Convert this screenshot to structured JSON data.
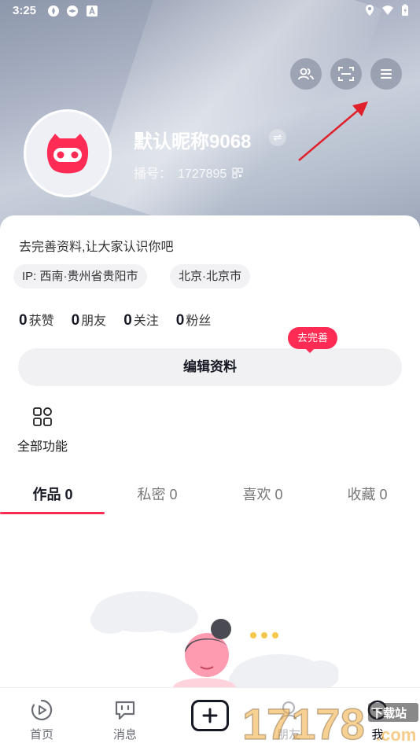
{
  "status_bar": {
    "time": "3:25"
  },
  "profile": {
    "nickname": "默认昵称9068",
    "account_label": "播号：",
    "account_id": "1727895",
    "complete_prompt": "去完善资料,让大家认识你吧",
    "tags": [
      "IP: 西南·贵州省贵阳市",
      "北京·北京市"
    ]
  },
  "stats": [
    {
      "count": "0",
      "label": "获赞"
    },
    {
      "count": "0",
      "label": "朋友"
    },
    {
      "count": "0",
      "label": "关注"
    },
    {
      "count": "0",
      "label": "粉丝"
    }
  ],
  "edit": {
    "bubble": "去完善",
    "button_label": "编辑资料"
  },
  "all_functions": "全部功能",
  "tabs": [
    {
      "label": "作品 0",
      "active": true
    },
    {
      "label": "私密 0",
      "active": false
    },
    {
      "label": "喜欢 0",
      "active": false
    },
    {
      "label": "收藏 0",
      "active": false
    }
  ],
  "bottom_nav": [
    {
      "label": "首页",
      "icon": "video-play-icon"
    },
    {
      "label": "消息",
      "icon": "message-icon"
    },
    {
      "label": "朋友",
      "icon": "friends-icon"
    },
    {
      "label": "我",
      "icon": "me-icon"
    }
  ],
  "watermark": {
    "text": "17178",
    "suffix": "下载站",
    "domain": ".com"
  },
  "colors": {
    "accent": "#fe2c55",
    "annotation_arrow": "#e0202a"
  }
}
